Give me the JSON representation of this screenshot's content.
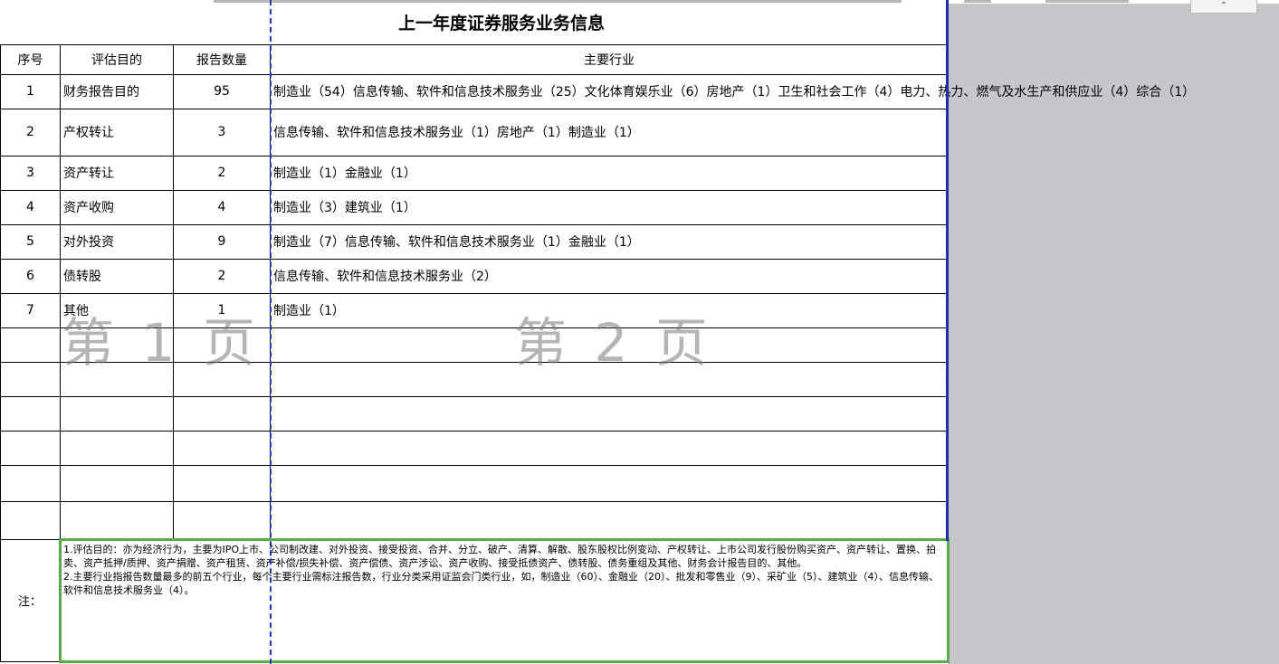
{
  "title": "上一年度证券服务业务信息",
  "headers": {
    "seq": "序号",
    "purpose": "评估目的",
    "count": "报告数量",
    "industry": "主要行业"
  },
  "rows": [
    {
      "seq": "1",
      "purpose": "财务报告目的",
      "count": "95",
      "industry": "制造业（54）信息传输、软件和信息技术服务业（25）文化体育娱乐业（6）房地产（1）卫生和社会工作（4）电力、热力、燃气及水生产和供应业（4）综合（1）"
    },
    {
      "seq": "2",
      "purpose": "产权转让",
      "count": "3",
      "industry": "信息传输、软件和信息技术服务业（1）房地产（1）制造业（1）"
    },
    {
      "seq": "3",
      "purpose": "资产转让",
      "count": "2",
      "industry": "制造业（1）金融业（1）"
    },
    {
      "seq": "4",
      "purpose": "资产收购",
      "count": "4",
      "industry": "制造业（3）建筑业（1）"
    },
    {
      "seq": "5",
      "purpose": "对外投资",
      "count": "9",
      "industry": "制造业（7）信息传输、软件和信息技术服务业（1）金融业（1）"
    },
    {
      "seq": "6",
      "purpose": "债转股",
      "count": "2",
      "industry": "信息传输、软件和信息技术服务业（2）"
    },
    {
      "seq": "7",
      "purpose": "其他",
      "count": "1",
      "industry": "制造业（1）"
    }
  ],
  "note": {
    "label": "注：",
    "line1": "1.评估目的：亦为经济行为，主要为IPO上市、公司制改建、对外投资、接受投资、合并、分立、破产、清算、解散、股东股权比例变动、产权转让、上市公司发行股份购买资产、资产转让、置换、拍卖、资产抵押/质押、资产捐赠、资产租赁、资产补偿/损失补偿、资产偿债、资产涉讼、资产收购、接受抵债资产、债转股、债务重组及其他、财务会计报告目的、其他。",
    "line2": "2.主要行业指报告数量最多的前五个行业，每个主要行业需标注报告数，行业分类采用证监会门类行业，如，制造业（60）、金融业（20）、批发和零售业（9）、采矿业（5）、建筑业（4）、信息传输、软件和信息技术服务业（4）。"
  },
  "watermarks": {
    "page1": "第 1 页",
    "page2": "第 2 页"
  },
  "colors": {
    "grid_border": "#000000",
    "print_area_border": "#1c2fb0",
    "page_break": "#2438c0",
    "selection_border": "#5aab4a",
    "outside_area": "#c8c6ca"
  },
  "icons": {
    "collapse": "chevron-up-icon"
  }
}
